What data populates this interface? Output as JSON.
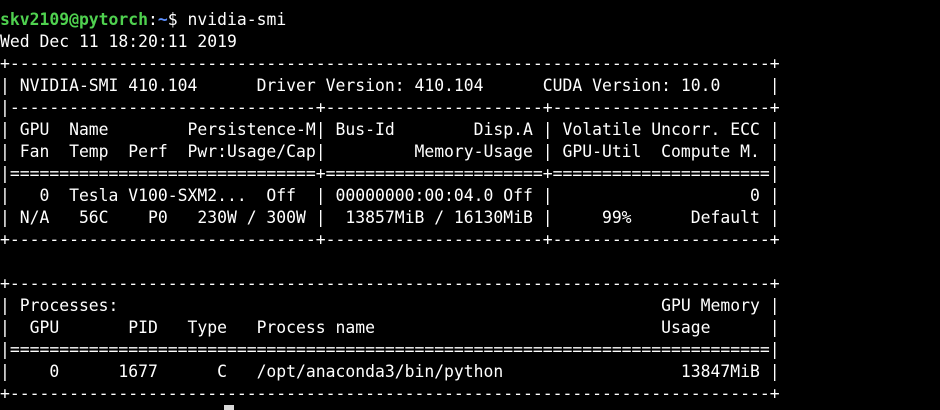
{
  "prompt": {
    "user_host": "skv2109@pytorch",
    "separator": ":",
    "path": "~",
    "symbol": "$",
    "command": " nvidia-smi"
  },
  "timestamp": "Wed Dec 11 18:20:11 2019",
  "output_lines": [
    "+-----------------------------------------------------------------------------+",
    "| NVIDIA-SMI 410.104      Driver Version: 410.104      CUDA Version: 10.0     |",
    "|-------------------------------+----------------------+----------------------+",
    "| GPU  Name        Persistence-M| Bus-Id        Disp.A | Volatile Uncorr. ECC |",
    "| Fan  Temp  Perf  Pwr:Usage/Cap|         Memory-Usage | GPU-Util  Compute M. |",
    "|===============================+======================+======================|",
    "|   0  Tesla V100-SXM2...  Off  | 00000000:00:04.0 Off |                    0 |",
    "| N/A   56C    P0   230W / 300W |  13857MiB / 16130MiB |     99%      Default |",
    "+-------------------------------+----------------------+----------------------+",
    "",
    "+-----------------------------------------------------------------------------+",
    "| Processes:                                                       GPU Memory |",
    "|  GPU       PID   Type   Process name                             Usage      |",
    "|=============================================================================|",
    "|    0      1677      C   /opt/anaconda3/bin/python                  13847MiB |",
    "+-----------------------------------------------------------------------------+"
  ]
}
